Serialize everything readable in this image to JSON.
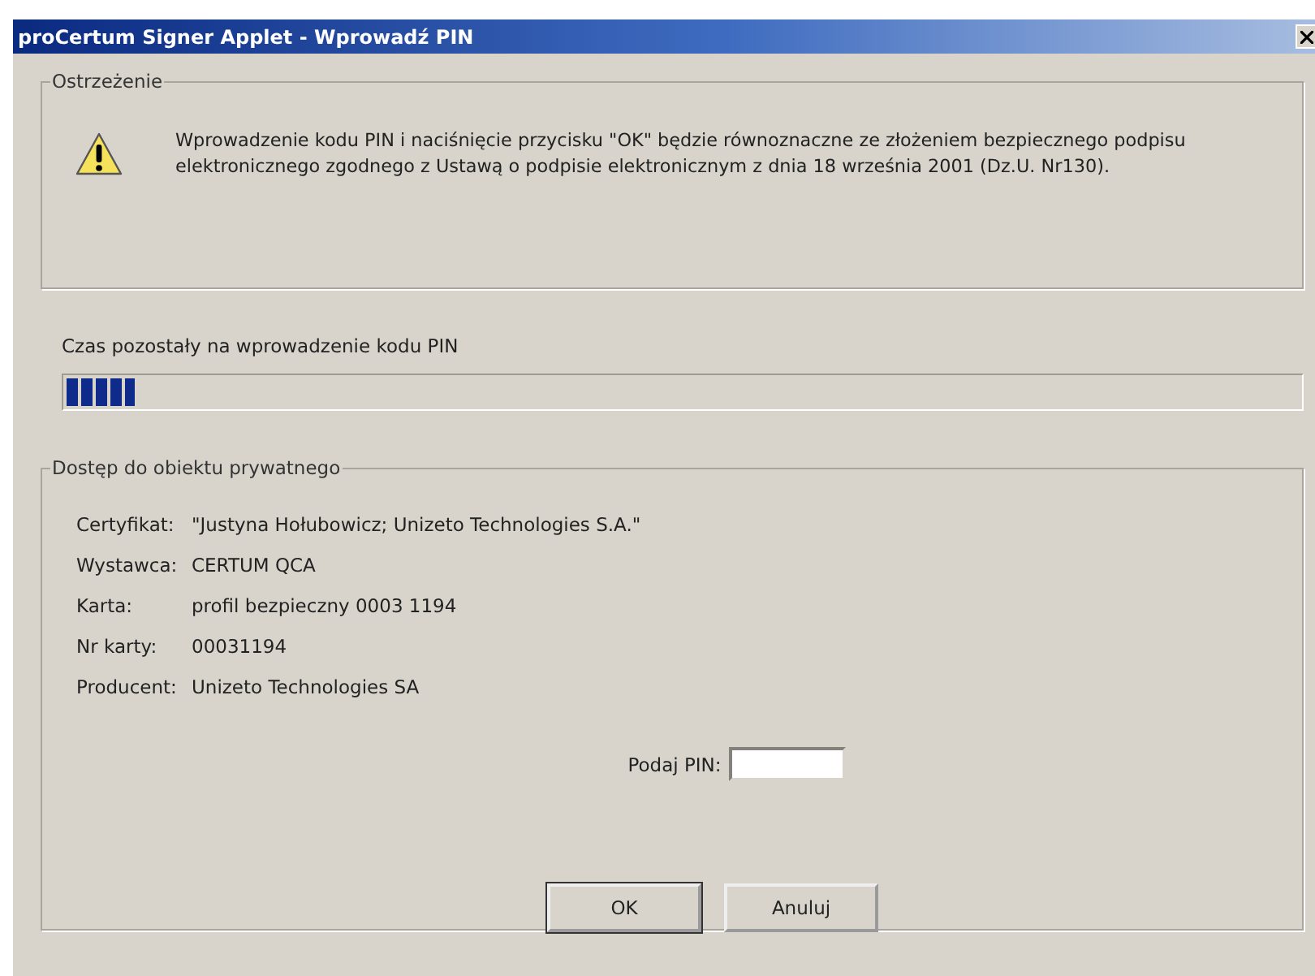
{
  "window": {
    "title": "proCertum Signer Applet - Wprowadź PIN"
  },
  "warning": {
    "legend": "Ostrzeżenie",
    "message": "Wprowadzenie kodu PIN i naciśnięcie przycisku \"OK\" będzie równoznaczne ze złożeniem bezpiecznego podpisu elektronicznego zgodnego z Ustawą o podpisie elektronicznym z dnia 18 września 2001 (Dz.U. Nr130)."
  },
  "timer": {
    "label": "Czas pozostały na wprowadzenie kodu PIN",
    "level": 0.055
  },
  "access": {
    "legend": "Dostęp do obiektu prywatnego",
    "fields": [
      {
        "label": "Certyfikat:",
        "value": "\"Justyna Hołubowicz; Unizeto Technologies S.A.\""
      },
      {
        "label": "Wystawca:",
        "value": "CERTUM QCA"
      },
      {
        "label": "Karta:",
        "value": "profil bezpieczny 0003 1194"
      },
      {
        "label": "Nr karty:",
        "value": "00031194"
      },
      {
        "label": "Producent:",
        "value": "Unizeto Technologies SA"
      }
    ],
    "pin": {
      "label": "Podaj PIN:"
    }
  },
  "buttons": [
    "OK",
    "Anuluj"
  ]
}
